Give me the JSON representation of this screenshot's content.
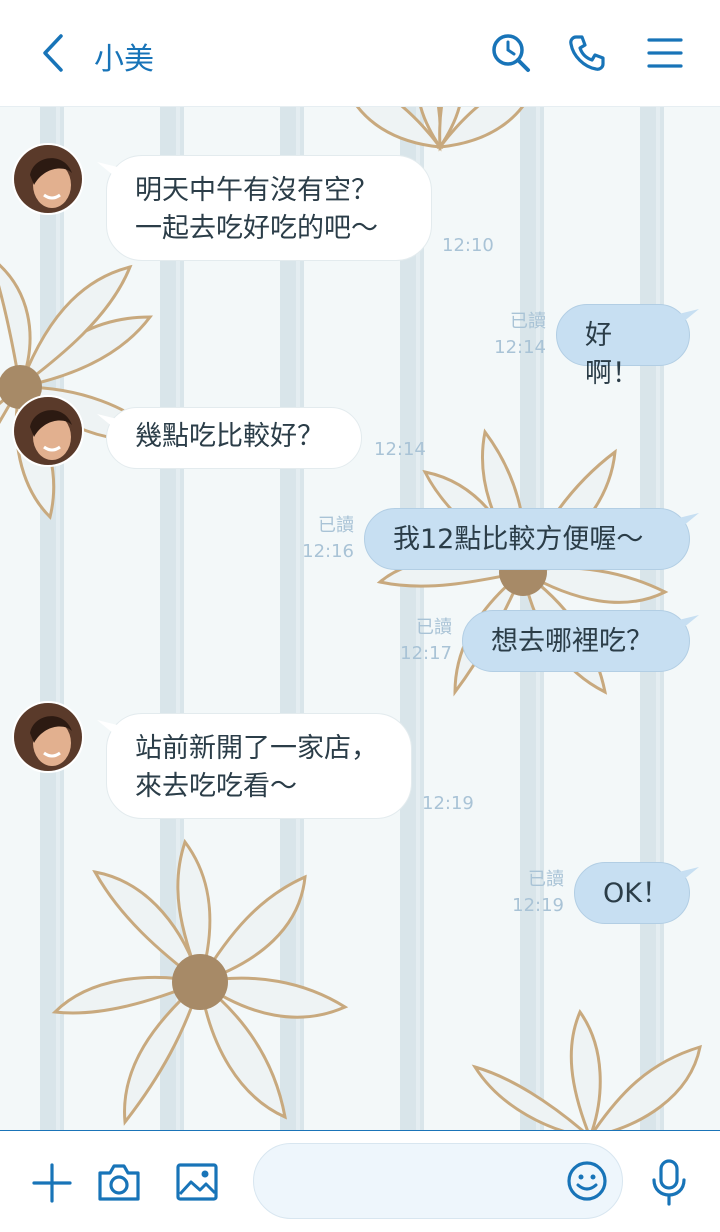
{
  "header": {
    "contact_name": "小美",
    "back_icon": "chevron-left-icon",
    "search_icon": "search-history-icon",
    "call_icon": "phone-icon",
    "menu_icon": "hamburger-menu-icon"
  },
  "colors": {
    "accent": "#1874b8",
    "outgoing_bubble": "#c7dff2",
    "incoming_bubble": "#ffffff",
    "meta_text": "#a9c3d6"
  },
  "messages": [
    {
      "direction": "in",
      "lines": [
        "明天中午有沒有空？",
        "一起去吃好吃的吧～"
      ],
      "time": "12:10"
    },
    {
      "direction": "out",
      "text": "好啊！",
      "read": "已讀",
      "time": "12:14"
    },
    {
      "direction": "in",
      "lines": [
        "幾點吃比較好？"
      ],
      "time": "12:14"
    },
    {
      "direction": "out",
      "text": "我12點比較方便喔～",
      "read": "已讀",
      "time": "12:16"
    },
    {
      "direction": "out",
      "text": "想去哪裡吃？",
      "read": "已讀",
      "time": "12:17"
    },
    {
      "direction": "in",
      "lines": [
        "站前新開了一家店，",
        "來去吃吃看～"
      ],
      "time": "12:19"
    },
    {
      "direction": "out",
      "text": "OK！",
      "read": "已讀",
      "time": "12:19"
    }
  ],
  "footer": {
    "plus_icon": "plus-icon",
    "camera_icon": "camera-icon",
    "image_icon": "image-icon",
    "input_placeholder": "",
    "emoji_icon": "emoji-icon",
    "mic_icon": "microphone-icon"
  }
}
